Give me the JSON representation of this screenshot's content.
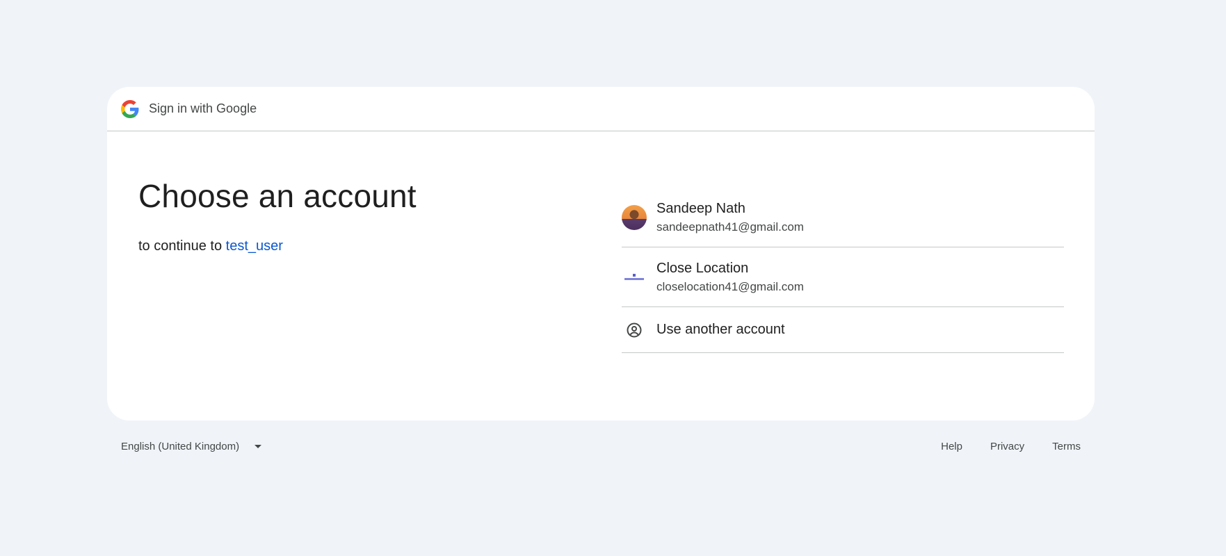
{
  "header": {
    "title": "Sign in with Google",
    "logo_icon": "google-g-icon"
  },
  "main": {
    "title": "Choose an account",
    "subtitle_prefix": "to continue to",
    "app_name": "test_user"
  },
  "accounts": [
    {
      "name": "Sandeep Nath",
      "email": "sandeepnath41@gmail.com",
      "avatar": "photo-avatar"
    },
    {
      "name": "Close Location",
      "email": "closelocation41@gmail.com",
      "avatar": "logo-avatar"
    }
  ],
  "another_account": {
    "label": "Use another account",
    "icon": "person-circle-icon"
  },
  "footer": {
    "language": "English (United Kingdom)",
    "links": [
      "Help",
      "Privacy",
      "Terms"
    ]
  },
  "colors": {
    "background": "#f0f4f9",
    "card": "#ffffff",
    "link": "#0b57d0",
    "divider": "#c4c7c5"
  }
}
